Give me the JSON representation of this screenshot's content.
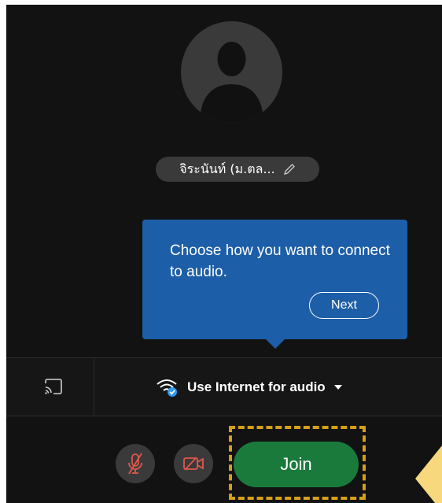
{
  "participant": {
    "name": "จิระนันท์ (ม.ตล...",
    "avatar_icon": "person-silhouette-icon",
    "edit_icon": "pencil-icon"
  },
  "tooltip": {
    "message": "Choose how you want to connect to audio.",
    "next_label": "Next"
  },
  "audio_bar": {
    "cast_icon": "cast-icon",
    "option_icon": "wifi-checked-icon",
    "option_label": "Use Internet for audio",
    "dropdown_icon": "caret-down-icon"
  },
  "controls": {
    "mic_icon": "microphone-muted-icon",
    "camera_icon": "camera-off-icon",
    "join_label": "Join"
  },
  "colors": {
    "background": "#121212",
    "tooltip_blue": "#1d5ea8",
    "join_green": "#1a7a3c",
    "muted_red": "#e0574c",
    "highlight_gold": "#d4a017",
    "wifi_check_blue": "#2f9cf2"
  }
}
